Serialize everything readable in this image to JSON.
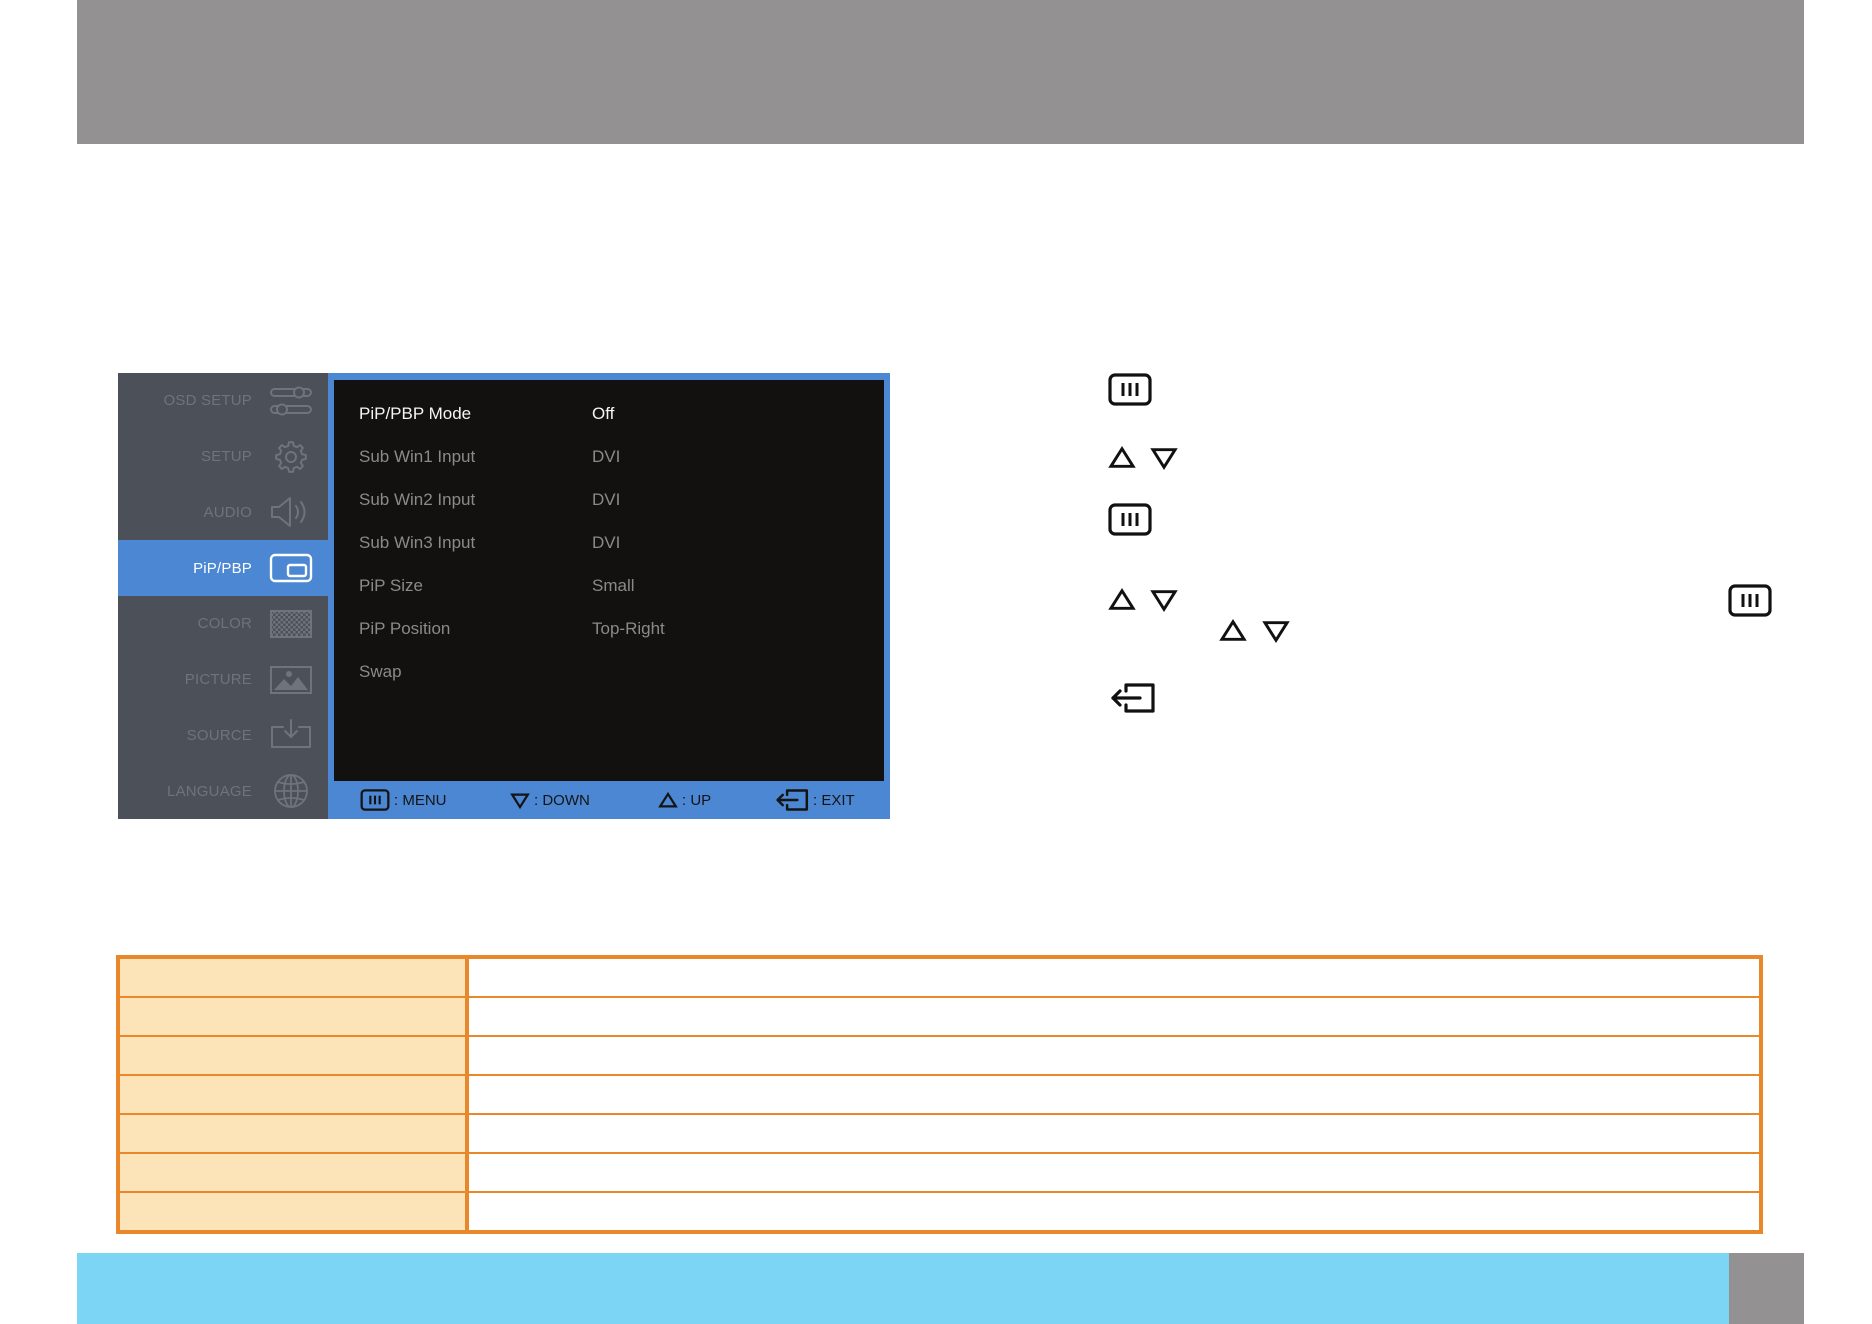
{
  "colors": {
    "header_bar": "#939191",
    "osd_accent": "#4b87d2",
    "osd_sidebar": "#4c5058",
    "osd_panel": "#121110",
    "table_border": "#e8882a",
    "table_label_fill": "#fce3b8",
    "footer_bar": "#7dd5f6",
    "page_tab": "#939191"
  },
  "osd": {
    "sidebar": [
      {
        "label": "OSD SETUP",
        "icon": "tools-icon"
      },
      {
        "label": "SETUP",
        "icon": "gear-icon"
      },
      {
        "label": "AUDIO",
        "icon": "speaker-icon"
      },
      {
        "label": "PiP/PBP",
        "icon": "pip-icon",
        "selected": true
      },
      {
        "label": "COLOR",
        "icon": "color-pattern-icon"
      },
      {
        "label": "PICTURE",
        "icon": "picture-icon"
      },
      {
        "label": "SOURCE",
        "icon": "source-icon"
      },
      {
        "label": "LANGUAGE",
        "icon": "globe-icon"
      }
    ],
    "settings": [
      {
        "label": "PiP/PBP Mode",
        "value": "Off",
        "highlighted": true
      },
      {
        "label": "Sub Win1 Input",
        "value": "DVI"
      },
      {
        "label": "Sub Win2 Input",
        "value": "DVI"
      },
      {
        "label": "Sub Win3 Input",
        "value": "DVI"
      },
      {
        "label": "PiP Size",
        "value": "Small"
      },
      {
        "label": "PiP Position",
        "value": "Top-Right"
      },
      {
        "label": "Swap"
      }
    ],
    "footer": [
      {
        "icon": "menu-icon",
        "label": ": MENU"
      },
      {
        "icon": "down-triangle-icon",
        "label": ": DOWN"
      },
      {
        "icon": "up-triangle-icon",
        "label": ": UP"
      },
      {
        "icon": "exit-icon",
        "label": ": EXIT"
      }
    ]
  },
  "instructions": {
    "steps": [
      {
        "icons": [
          "menu-icon"
        ]
      },
      {
        "icons": [
          "up-triangle-icon",
          "down-triangle-icon"
        ]
      },
      {
        "icons": [
          "menu-icon"
        ]
      },
      {
        "icons": [
          "up-triangle-icon",
          "down-triangle-icon",
          "menu-icon",
          "up-triangle-icon",
          "down-triangle-icon"
        ]
      },
      {
        "icons": [
          "exit-icon"
        ]
      }
    ]
  }
}
